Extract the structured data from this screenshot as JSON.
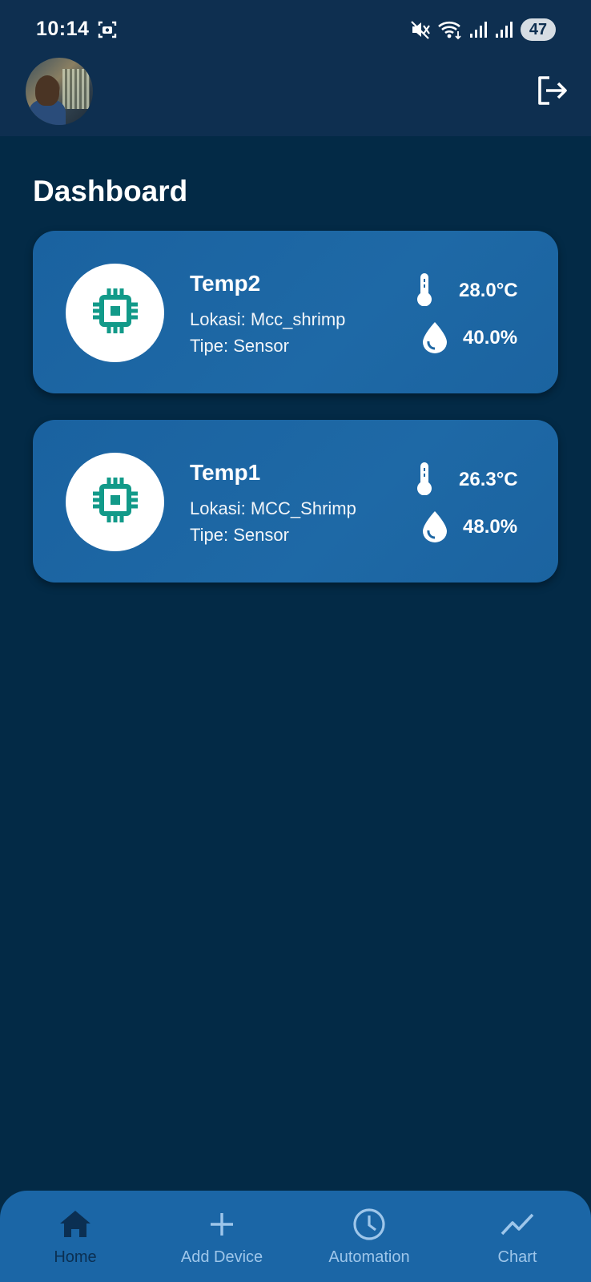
{
  "status_bar": {
    "time": "10:14",
    "battery": "47",
    "icons": [
      "screenshot-icon",
      "mute-vibrate-icon",
      "wifi-icon",
      "signal-icon",
      "signal-icon"
    ]
  },
  "header": {
    "avatar": "user-avatar",
    "logout_icon": "logout-icon"
  },
  "page": {
    "title": "Dashboard"
  },
  "devices": [
    {
      "name": "Temp2",
      "location": "Lokasi: Mcc_shrimp",
      "type": "Tipe: Sensor",
      "temperature": "28.0°C",
      "humidity": "40.0%",
      "icon": "chip-icon"
    },
    {
      "name": "Temp1",
      "location": "Lokasi: MCC_Shrimp",
      "type": "Tipe: Sensor",
      "temperature": "26.3°C",
      "humidity": "48.0%",
      "icon": "chip-icon"
    }
  ],
  "bottom_nav": {
    "items": [
      {
        "label": "Home",
        "icon": "home-icon",
        "active": true
      },
      {
        "label": "Add Device",
        "icon": "plus-icon",
        "active": false
      },
      {
        "label": "Automation",
        "icon": "clock-icon",
        "active": false
      },
      {
        "label": "Chart",
        "icon": "chart-icon",
        "active": false
      }
    ]
  },
  "colors": {
    "background": "#032a46",
    "app_bar": "#0e2f50",
    "card": "#1d66a3",
    "chip_icon": "#129a89",
    "nav_bar": "#1b66a6",
    "nav_active": "#0b2f52",
    "nav_inactive": "#9ec6ea"
  }
}
